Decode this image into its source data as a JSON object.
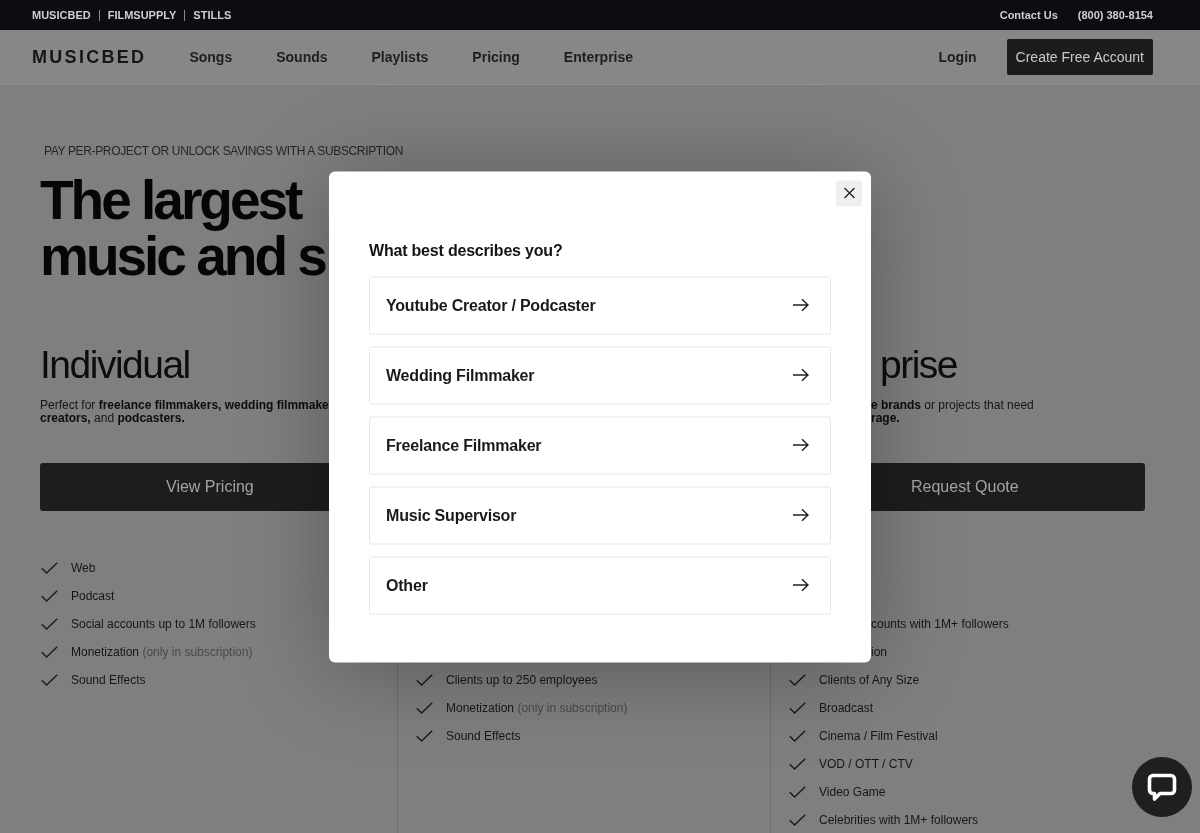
{
  "top_bar": {
    "links": [
      "MUSICBED",
      "FILMSUPPLY",
      "STILLS"
    ],
    "contact": "Contact Us",
    "phone": "(800) 380-8154"
  },
  "nav": {
    "logo": "MUSICBED",
    "links": [
      "Songs",
      "Sounds",
      "Playlists",
      "Pricing",
      "Enterprise"
    ],
    "login": "Login",
    "cta": "Create Free Account"
  },
  "hero": {
    "eyebrow": "PAY PER-PROJECT OR UNLOCK SAVINGS WITH A SUBSCRIPTION",
    "title_lines": [
      "The largest",
      "music and s"
    ]
  },
  "plans": [
    {
      "title": "Individual",
      "description_lines": [
        "Perfect for **freelance filmmakers, wedding filmmake**",
        "**creators,** and **podcasters.**"
      ],
      "button": "View Pricing",
      "features": [
        {
          "kind": "check",
          "text": "Web"
        },
        {
          "kind": "check",
          "text": "Podcast"
        },
        {
          "kind": "check",
          "text": "Social accounts up to 1M followers"
        },
        {
          "kind": "check",
          "text": "Monetization",
          "note": "(only in subscription)"
        },
        {
          "kind": "check",
          "text": "Sound Effects"
        }
      ]
    },
    {
      "features": [
        {
          "kind": "check",
          "text": "Clients up to 250 employees"
        },
        {
          "kind": "check",
          "text": "Monetization",
          "note": "(only in subscription)"
        },
        {
          "kind": "check",
          "text": "Sound Effects"
        }
      ]
    },
    {
      "title": "prise",
      "description_lines": [
        "**e brands** or projects that need",
        "**rage.**"
      ],
      "button": "Request Quote",
      "features": [
        {
          "kind": "cut",
          "text": "counts with 1M+ followers"
        },
        {
          "kind": "cut",
          "text": "ion"
        },
        {
          "kind": "check",
          "text": "Clients of Any Size"
        },
        {
          "kind": "check",
          "text": "Broadcast"
        },
        {
          "kind": "check",
          "text": "Cinema / Film Festival"
        },
        {
          "kind": "check",
          "text": "VOD / OTT / CTV"
        },
        {
          "kind": "check",
          "text": "Video Game"
        },
        {
          "kind": "check",
          "text": "Celebrities with 1M+ followers"
        }
      ]
    }
  ],
  "modal": {
    "question": "What best describes you?",
    "options": [
      "Youtube Creator / Podcaster",
      "Wedding Filmmaker",
      "Freelance Filmmaker",
      "Music Supervisor",
      "Other"
    ]
  }
}
